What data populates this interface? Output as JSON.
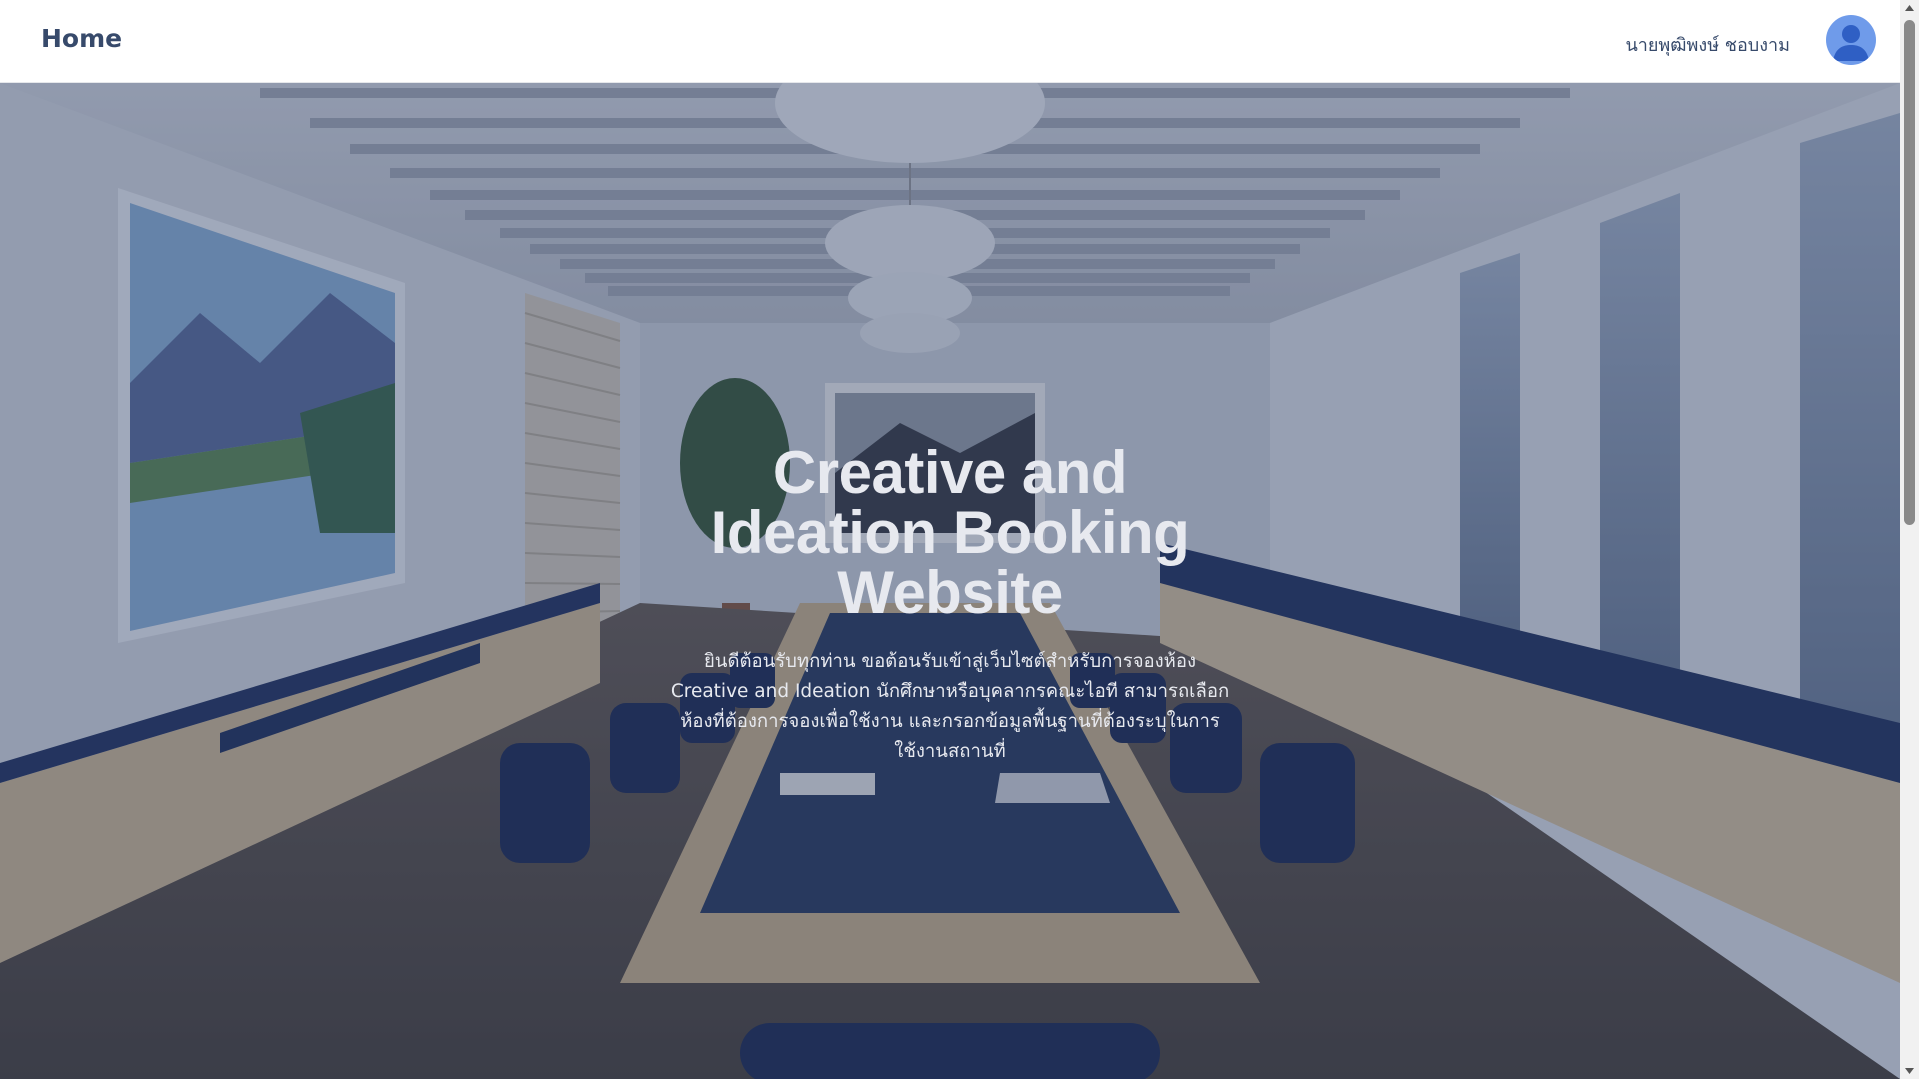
{
  "header": {
    "home_label": "Home",
    "user_name": "นายพุฒิพงษ์ ชอบงาม"
  },
  "hero": {
    "title": "Creative and Ideation Booking Website",
    "description": "ยินดีต้อนรับทุกท่าน ขอต้อนรับเข้าสู่เว็บไซต์สำหรับการจองห้อง Creative and Ideation นักศึกษาหรือบุคลากรคณะไอที สามารถเลือกห้องที่ต้องการจองเพื่อใช้งาน และกรอกข้อมูลพื้นฐานที่ต้องระบุในการใช้งานสถานที่"
  },
  "colors": {
    "nav_text": "#374a6b",
    "avatar_bg": "#6f9bea",
    "overlay": "#22346060",
    "hero_text": "#e7e9ef"
  },
  "icons": {
    "avatar": "user-avatar-icon",
    "scroll_up": "arrow-up-icon",
    "scroll_down": "arrow-down-icon"
  }
}
